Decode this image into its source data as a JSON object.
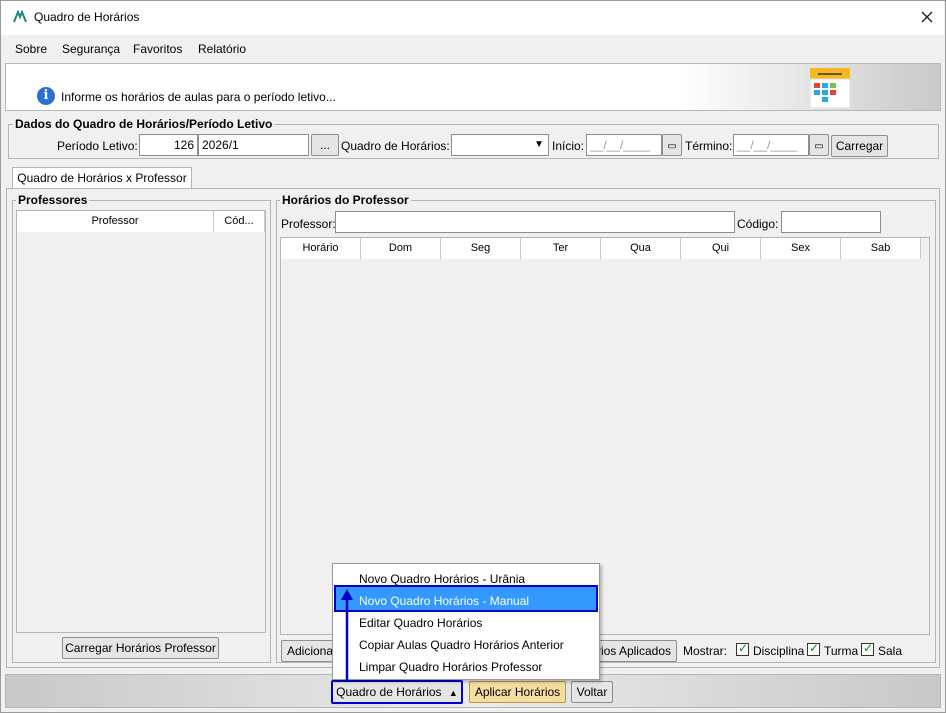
{
  "window": {
    "title": "Quadro de Horários",
    "close_icon": "close-icon"
  },
  "menu": [
    "Sobre",
    "Segurança",
    "Favoritos",
    "Relatório"
  ],
  "banner": {
    "info_text": "Informe os horários de aulas para o período letivo..."
  },
  "dados": {
    "title": "Dados do Quadro de Horários/Período Letivo",
    "periodo_label": "Período Letivo:",
    "periodo_code": "126",
    "periodo_value": "2026/1",
    "ellipsis": "...",
    "quadro_label": "Quadro de Horários:",
    "inicio_label": "Início:",
    "inicio_value": "__/__/____",
    "termino_label": "Término:",
    "termino_value": "__/__/____",
    "carregar": "Carregar"
  },
  "tab": {
    "label": "Quadro de Horários x Professor"
  },
  "professores": {
    "title": "Professores",
    "columns": [
      "Professor",
      "Cód..."
    ],
    "load_button": "Carregar Horários Professor"
  },
  "horarios": {
    "title": "Horários do Professor",
    "professor_label": "Professor:",
    "codigo_label": "Código:",
    "columns": [
      "Horário",
      "Dom",
      "Seg",
      "Ter",
      "Qua",
      "Qui",
      "Sex",
      "Sab"
    ],
    "adicionar_partial": "Adiciona",
    "aplicados_partial": "rios Aplicados",
    "mostrar_label": "Mostrar:",
    "checks": [
      "Disciplina",
      "Turma",
      "Sala"
    ]
  },
  "popup_menu": {
    "items": [
      "Novo Quadro Horários - Urânia",
      "Novo Quadro Horários - Manual",
      "Editar Quadro Horários",
      "Copiar Aulas Quadro Horários Anterior",
      "Limpar Quadro Horários Professor"
    ],
    "selected_index": 1,
    "highlight_color": "#3399ff",
    "annotation_color": "#0000cc"
  },
  "footer": {
    "quadro_button": "Quadro de Horários",
    "aplicar_button": "Aplicar Horários",
    "voltar_button": "Voltar"
  }
}
